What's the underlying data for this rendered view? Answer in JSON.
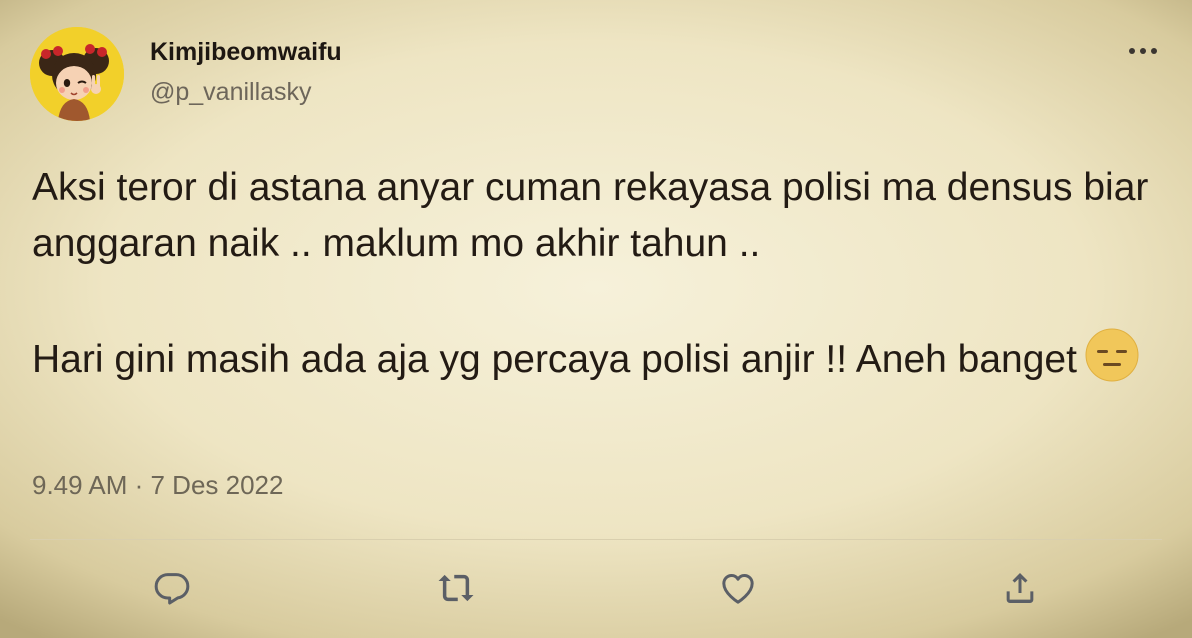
{
  "author": {
    "display_name": "Kimjibeomwaifu",
    "handle": "@p_vanillasky"
  },
  "tweet": {
    "paragraph_1": "Aksi teror di astana anyar cuman rekayasa polisi ma densus biar anggaran naik .. maklum mo akhir tahun ..",
    "paragraph_2": "Hari gini masih ada aja yg percaya polisi anjir !! Aneh banget",
    "emoji": "expressionless-face",
    "timestamp": "9.49 AM · 7 Des 2022"
  },
  "actions": [
    "reply-icon",
    "retweet-icon",
    "like-icon",
    "share-icon"
  ],
  "colors": {
    "background": "#f0e8c8",
    "text": "#231b14",
    "muted": "#6e6757",
    "avatar_bg": "#f2d02a",
    "icon": "#5b5f66"
  }
}
